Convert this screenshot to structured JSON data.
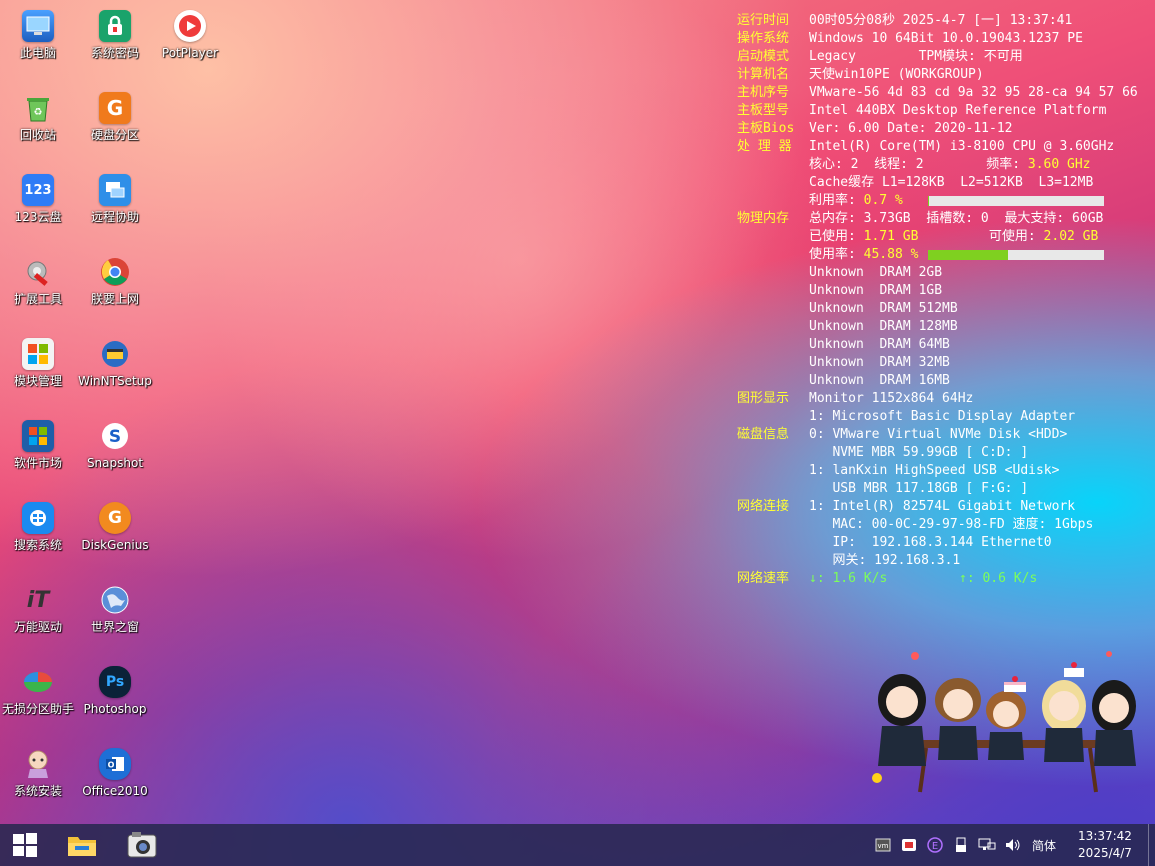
{
  "desktop": {
    "icons": [
      {
        "label": "此电脑",
        "icon": "computer-icon"
      },
      {
        "label": "系统密码",
        "icon": "lock-icon"
      },
      {
        "label": "PotPlayer",
        "icon": "play-icon"
      },
      {
        "label": "回收站",
        "icon": "recycle-bin-icon"
      },
      {
        "label": "硬盘分区",
        "icon": "partition-icon"
      },
      {
        "label": "123云盘",
        "icon": "cloud-icon"
      },
      {
        "label": "远程协助",
        "icon": "remote-icon"
      },
      {
        "label": "扩展工具",
        "icon": "tools-icon"
      },
      {
        "label": "朕要上网",
        "icon": "chrome-icon"
      },
      {
        "label": "模块管理",
        "icon": "module-icon"
      },
      {
        "label": "WinNTSetup",
        "icon": "setup-icon"
      },
      {
        "label": "软件市场",
        "icon": "store-icon"
      },
      {
        "label": "Snapshot",
        "icon": "snapshot-icon"
      },
      {
        "label": "搜索系统",
        "icon": "search-system-icon"
      },
      {
        "label": "DiskGenius",
        "icon": "diskgenius-icon"
      },
      {
        "label": "万能驱动",
        "icon": "driver-icon"
      },
      {
        "label": "世界之窗",
        "icon": "globe-icon"
      },
      {
        "label": "无损分区助手",
        "icon": "partition-assistant-icon"
      },
      {
        "label": "Photoshop",
        "icon": "photoshop-icon"
      },
      {
        "label": "系统安装",
        "icon": "install-icon"
      },
      {
        "label": "Office2010",
        "icon": "office-icon"
      }
    ]
  },
  "sysinfo": {
    "runtime_key": "运行时间",
    "runtime_val": "00时05分08秒 2025-4-7 [一] 13:37:41",
    "os_key": "操作系统",
    "os_val": "Windows 10 64Bit 10.0.19043.1237 PE",
    "boot_key": "启动模式",
    "boot_val": "Legacy        TPM模块: 不可用",
    "pcname_key": "计算机名",
    "pcname_val": "天使win10PE (WORKGROUP)",
    "serial_key": "主机序号",
    "serial_val": "VMware-56 4d 83 cd 9a 32 95 28-ca 94 57 66",
    "board_key": "主板型号",
    "board_val": "Intel 440BX Desktop Reference Platform",
    "bios_key": "主板Bios",
    "bios_val": "Ver: 6.00 Date: 2020-11-12",
    "cpu_key": "处 理 器",
    "cpu_val": "Intel(R) Core(TM) i3-8100 CPU @ 3.60GHz",
    "cores_val": "核心: 2  线程: 2        频率: ",
    "freq_val": "3.60 GHz",
    "cache_val": "Cache缓存 L1=128KB  L2=512KB  L3=12MB",
    "cpu_usage_label": "利用率: ",
    "cpu_usage_val": "0.7 %",
    "cpu_usage_fraction": 0.007,
    "mem_key": "物理内存",
    "mem_total_val": "总内存: 3.73GB  插槽数: 0  最大支持: 60GB",
    "mem_used_label": "已使用: ",
    "mem_used_val": "1.71 GB",
    "mem_avail_label": "         可使用: ",
    "mem_avail_val": "2.02 GB",
    "mem_usage_label": "使用率: ",
    "mem_usage_val": "45.88 %",
    "mem_usage_fraction": 0.4588,
    "dram": [
      "Unknown  DRAM 2GB",
      "Unknown  DRAM 1GB",
      "Unknown  DRAM 512MB",
      "Unknown  DRAM 128MB",
      "Unknown  DRAM 64MB",
      "Unknown  DRAM 32MB",
      "Unknown  DRAM 16MB"
    ],
    "gfx_key": "图形显示",
    "gfx_val1": "Monitor 1152x864 64Hz",
    "gfx_val2": "1: Microsoft Basic Display Adapter",
    "disk_key": "磁盘信息",
    "disk_val1": "0: VMware Virtual NVMe Disk <HDD>",
    "disk_val2": "   NVME MBR 59.99GB [ C:D: ]",
    "disk_val3": "1: lanKxin HighSpeed USB <Udisk>",
    "disk_val4": "   USB MBR 117.18GB [ F:G: ]",
    "net_key": "网络连接",
    "net_val1": "1: Intel(R) 82574L Gigabit Network",
    "net_val2": "   MAC: 00-0C-29-97-98-FD 速度: 1Gbps",
    "net_val3": "   IP:  192.168.3.144 Ethernet0",
    "net_val4": "   网关: 192.168.3.1",
    "speed_key": "网络速率",
    "speed_down": "↓: 1.6 K/s",
    "speed_up": "↑: 0.6 K/s"
  },
  "taskbar": {
    "start": "start-icon",
    "pinned": [
      "file-explorer-icon",
      "camera-icon"
    ],
    "tray_icons": [
      "vmware-icon",
      "security-icon",
      "e-icon",
      "usb-icon",
      "network-icon",
      "volume-icon"
    ],
    "language": "简体",
    "time": "13:37:42",
    "date": "2025/4/7"
  },
  "colors": {
    "key": "#ffff33",
    "value": "#ffffff",
    "accent_green": "#7dff5a",
    "bar_fill": "#7fd020",
    "taskbar": "#282850"
  }
}
